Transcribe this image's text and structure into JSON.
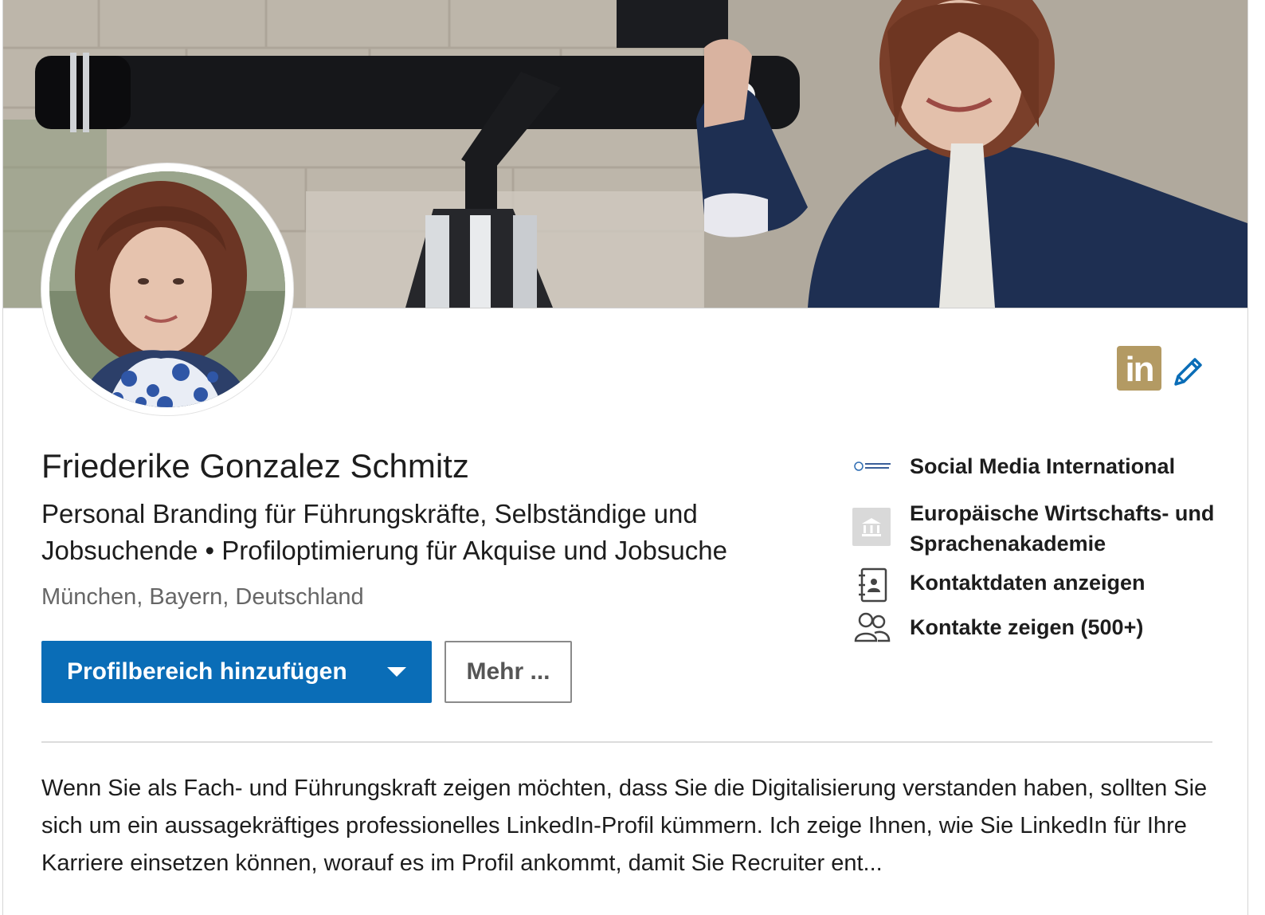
{
  "profile": {
    "name": "Friederike Gonzalez Schmitz",
    "headline": "Personal Branding für Führungskräfte, Selbständige und Jobsuchende • Profiloptimierung für Akquise und Jobsuche",
    "location": "München, Bayern, Deutschland"
  },
  "actions": {
    "primary_label": "Profilbereich hinzufügen",
    "more_label": "Mehr ..."
  },
  "badge": {
    "text": "in",
    "color": "#b39a63"
  },
  "sidebar": {
    "company": "Social Media International",
    "education": "Europäische Wirtschafts- und Sprachenakademie",
    "contact_info": "Kontaktdaten anzeigen",
    "connections": "Kontakte zeigen (500+)"
  },
  "about": {
    "text": "Wenn Sie als Fach- und Führungskraft zeigen möchten, dass Sie die Digitalisierung verstanden haben, sollten Sie sich um ein aussagekräftiges professionelles LinkedIn-Profil kümmern. Ich zeige Ihnen, wie Sie LinkedIn für Ihre Karriere einsetzen können, worauf es im Profil ankommt, damit Sie Recruiter ent..."
  },
  "colors": {
    "primary_button": "#0a6db7",
    "accent_icon": "#0a6db7"
  },
  "icons": {
    "edit": "pencil-icon",
    "company": "company-logo-icon",
    "education": "school-icon",
    "contact": "contact-book-icon",
    "connections": "people-icon"
  }
}
